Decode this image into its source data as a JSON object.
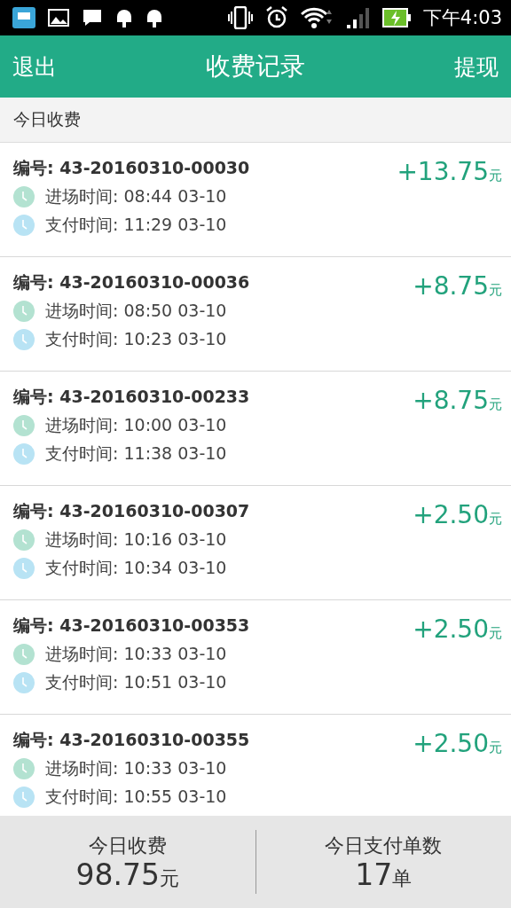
{
  "status_bar": {
    "time": "下午4:03"
  },
  "header": {
    "left": "退出",
    "title": "收费记录",
    "right": "提现"
  },
  "section": {
    "title": "今日收费"
  },
  "records": [
    {
      "number_label": "编号:",
      "number": "43-20160310-00030",
      "amount": "+13.75",
      "unit": "元",
      "times": [
        {
          "kind": "entry",
          "label": "进场时间:",
          "value": "08:44 03-10"
        },
        {
          "kind": "pay",
          "label": "支付时间:",
          "value": "11:29 03-10"
        }
      ]
    },
    {
      "number_label": "编号:",
      "number": "43-20160310-00036",
      "amount": "+8.75",
      "unit": "元",
      "times": [
        {
          "kind": "entry",
          "label": "进场时间:",
          "value": "08:50 03-10"
        },
        {
          "kind": "pay",
          "label": "支付时间:",
          "value": "10:23 03-10"
        }
      ]
    },
    {
      "number_label": "编号:",
      "number": "43-20160310-00233",
      "amount": "+8.75",
      "unit": "元",
      "times": [
        {
          "kind": "entry",
          "label": "进场时间:",
          "value": "10:00 03-10"
        },
        {
          "kind": "pay",
          "label": "支付时间:",
          "value": "11:38 03-10"
        }
      ]
    },
    {
      "number_label": "编号:",
      "number": "43-20160310-00307",
      "amount": "+2.50",
      "unit": "元",
      "times": [
        {
          "kind": "entry",
          "label": "进场时间:",
          "value": "10:16 03-10"
        },
        {
          "kind": "pay",
          "label": "支付时间:",
          "value": "10:34 03-10"
        }
      ]
    },
    {
      "number_label": "编号:",
      "number": "43-20160310-00353",
      "amount": "+2.50",
      "unit": "元",
      "times": [
        {
          "kind": "entry",
          "label": "进场时间:",
          "value": "10:33 03-10"
        },
        {
          "kind": "pay",
          "label": "支付时间:",
          "value": "10:51 03-10"
        }
      ]
    },
    {
      "number_label": "编号:",
      "number": "43-20160310-00355",
      "amount": "+2.50",
      "unit": "元",
      "times": [
        {
          "kind": "entry",
          "label": "进场时间:",
          "value": "10:33 03-10"
        },
        {
          "kind": "pay",
          "label": "支付时间:",
          "value": "10:55 03-10"
        }
      ]
    }
  ],
  "footer": [
    {
      "label": "今日收费",
      "value": "98.75",
      "unit": "元"
    },
    {
      "label": "今日支付单数",
      "value": "17",
      "unit": "单"
    }
  ]
}
